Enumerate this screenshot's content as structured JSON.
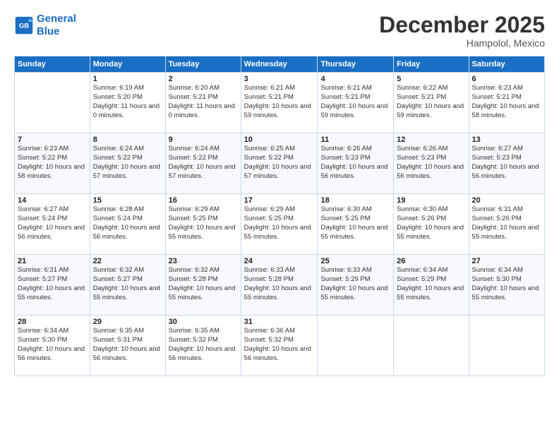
{
  "logo": {
    "line1": "General",
    "line2": "Blue"
  },
  "header": {
    "month": "December 2025",
    "location": "Hampolol, Mexico"
  },
  "weekdays": [
    "Sunday",
    "Monday",
    "Tuesday",
    "Wednesday",
    "Thursday",
    "Friday",
    "Saturday"
  ],
  "weeks": [
    [
      {
        "day": "",
        "sunrise": "",
        "sunset": "",
        "daylight": ""
      },
      {
        "day": "1",
        "sunrise": "Sunrise: 6:19 AM",
        "sunset": "Sunset: 5:20 PM",
        "daylight": "Daylight: 11 hours and 0 minutes."
      },
      {
        "day": "2",
        "sunrise": "Sunrise: 6:20 AM",
        "sunset": "Sunset: 5:21 PM",
        "daylight": "Daylight: 11 hours and 0 minutes."
      },
      {
        "day": "3",
        "sunrise": "Sunrise: 6:21 AM",
        "sunset": "Sunset: 5:21 PM",
        "daylight": "Daylight: 10 hours and 59 minutes."
      },
      {
        "day": "4",
        "sunrise": "Sunrise: 6:21 AM",
        "sunset": "Sunset: 5:21 PM",
        "daylight": "Daylight: 10 hours and 59 minutes."
      },
      {
        "day": "5",
        "sunrise": "Sunrise: 6:22 AM",
        "sunset": "Sunset: 5:21 PM",
        "daylight": "Daylight: 10 hours and 59 minutes."
      },
      {
        "day": "6",
        "sunrise": "Sunrise: 6:23 AM",
        "sunset": "Sunset: 5:21 PM",
        "daylight": "Daylight: 10 hours and 58 minutes."
      }
    ],
    [
      {
        "day": "7",
        "sunrise": "Sunrise: 6:23 AM",
        "sunset": "Sunset: 5:22 PM",
        "daylight": "Daylight: 10 hours and 58 minutes."
      },
      {
        "day": "8",
        "sunrise": "Sunrise: 6:24 AM",
        "sunset": "Sunset: 5:22 PM",
        "daylight": "Daylight: 10 hours and 57 minutes."
      },
      {
        "day": "9",
        "sunrise": "Sunrise: 6:24 AM",
        "sunset": "Sunset: 5:22 PM",
        "daylight": "Daylight: 10 hours and 57 minutes."
      },
      {
        "day": "10",
        "sunrise": "Sunrise: 6:25 AM",
        "sunset": "Sunset: 5:22 PM",
        "daylight": "Daylight: 10 hours and 57 minutes."
      },
      {
        "day": "11",
        "sunrise": "Sunrise: 6:26 AM",
        "sunset": "Sunset: 5:23 PM",
        "daylight": "Daylight: 10 hours and 56 minutes."
      },
      {
        "day": "12",
        "sunrise": "Sunrise: 6:26 AM",
        "sunset": "Sunset: 5:23 PM",
        "daylight": "Daylight: 10 hours and 56 minutes."
      },
      {
        "day": "13",
        "sunrise": "Sunrise: 6:27 AM",
        "sunset": "Sunset: 5:23 PM",
        "daylight": "Daylight: 10 hours and 56 minutes."
      }
    ],
    [
      {
        "day": "14",
        "sunrise": "Sunrise: 6:27 AM",
        "sunset": "Sunset: 5:24 PM",
        "daylight": "Daylight: 10 hours and 56 minutes."
      },
      {
        "day": "15",
        "sunrise": "Sunrise: 6:28 AM",
        "sunset": "Sunset: 5:24 PM",
        "daylight": "Daylight: 10 hours and 56 minutes."
      },
      {
        "day": "16",
        "sunrise": "Sunrise: 6:29 AM",
        "sunset": "Sunset: 5:25 PM",
        "daylight": "Daylight: 10 hours and 55 minutes."
      },
      {
        "day": "17",
        "sunrise": "Sunrise: 6:29 AM",
        "sunset": "Sunset: 5:25 PM",
        "daylight": "Daylight: 10 hours and 55 minutes."
      },
      {
        "day": "18",
        "sunrise": "Sunrise: 6:30 AM",
        "sunset": "Sunset: 5:25 PM",
        "daylight": "Daylight: 10 hours and 55 minutes."
      },
      {
        "day": "19",
        "sunrise": "Sunrise: 6:30 AM",
        "sunset": "Sunset: 5:26 PM",
        "daylight": "Daylight: 10 hours and 55 minutes."
      },
      {
        "day": "20",
        "sunrise": "Sunrise: 6:31 AM",
        "sunset": "Sunset: 5:26 PM",
        "daylight": "Daylight: 10 hours and 55 minutes."
      }
    ],
    [
      {
        "day": "21",
        "sunrise": "Sunrise: 6:31 AM",
        "sunset": "Sunset: 5:27 PM",
        "daylight": "Daylight: 10 hours and 55 minutes."
      },
      {
        "day": "22",
        "sunrise": "Sunrise: 6:32 AM",
        "sunset": "Sunset: 5:27 PM",
        "daylight": "Daylight: 10 hours and 55 minutes."
      },
      {
        "day": "23",
        "sunrise": "Sunrise: 6:32 AM",
        "sunset": "Sunset: 5:28 PM",
        "daylight": "Daylight: 10 hours and 55 minutes."
      },
      {
        "day": "24",
        "sunrise": "Sunrise: 6:33 AM",
        "sunset": "Sunset: 5:28 PM",
        "daylight": "Daylight: 10 hours and 55 minutes."
      },
      {
        "day": "25",
        "sunrise": "Sunrise: 6:33 AM",
        "sunset": "Sunset: 5:29 PM",
        "daylight": "Daylight: 10 hours and 55 minutes."
      },
      {
        "day": "26",
        "sunrise": "Sunrise: 6:34 AM",
        "sunset": "Sunset: 5:29 PM",
        "daylight": "Daylight: 10 hours and 55 minutes."
      },
      {
        "day": "27",
        "sunrise": "Sunrise: 6:34 AM",
        "sunset": "Sunset: 5:30 PM",
        "daylight": "Daylight: 10 hours and 55 minutes."
      }
    ],
    [
      {
        "day": "28",
        "sunrise": "Sunrise: 6:34 AM",
        "sunset": "Sunset: 5:30 PM",
        "daylight": "Daylight: 10 hours and 56 minutes."
      },
      {
        "day": "29",
        "sunrise": "Sunrise: 6:35 AM",
        "sunset": "Sunset: 5:31 PM",
        "daylight": "Daylight: 10 hours and 56 minutes."
      },
      {
        "day": "30",
        "sunrise": "Sunrise: 6:35 AM",
        "sunset": "Sunset: 5:32 PM",
        "daylight": "Daylight: 10 hours and 56 minutes."
      },
      {
        "day": "31",
        "sunrise": "Sunrise: 6:36 AM",
        "sunset": "Sunset: 5:32 PM",
        "daylight": "Daylight: 10 hours and 56 minutes."
      },
      {
        "day": "",
        "sunrise": "",
        "sunset": "",
        "daylight": ""
      },
      {
        "day": "",
        "sunrise": "",
        "sunset": "",
        "daylight": ""
      },
      {
        "day": "",
        "sunrise": "",
        "sunset": "",
        "daylight": ""
      }
    ]
  ]
}
